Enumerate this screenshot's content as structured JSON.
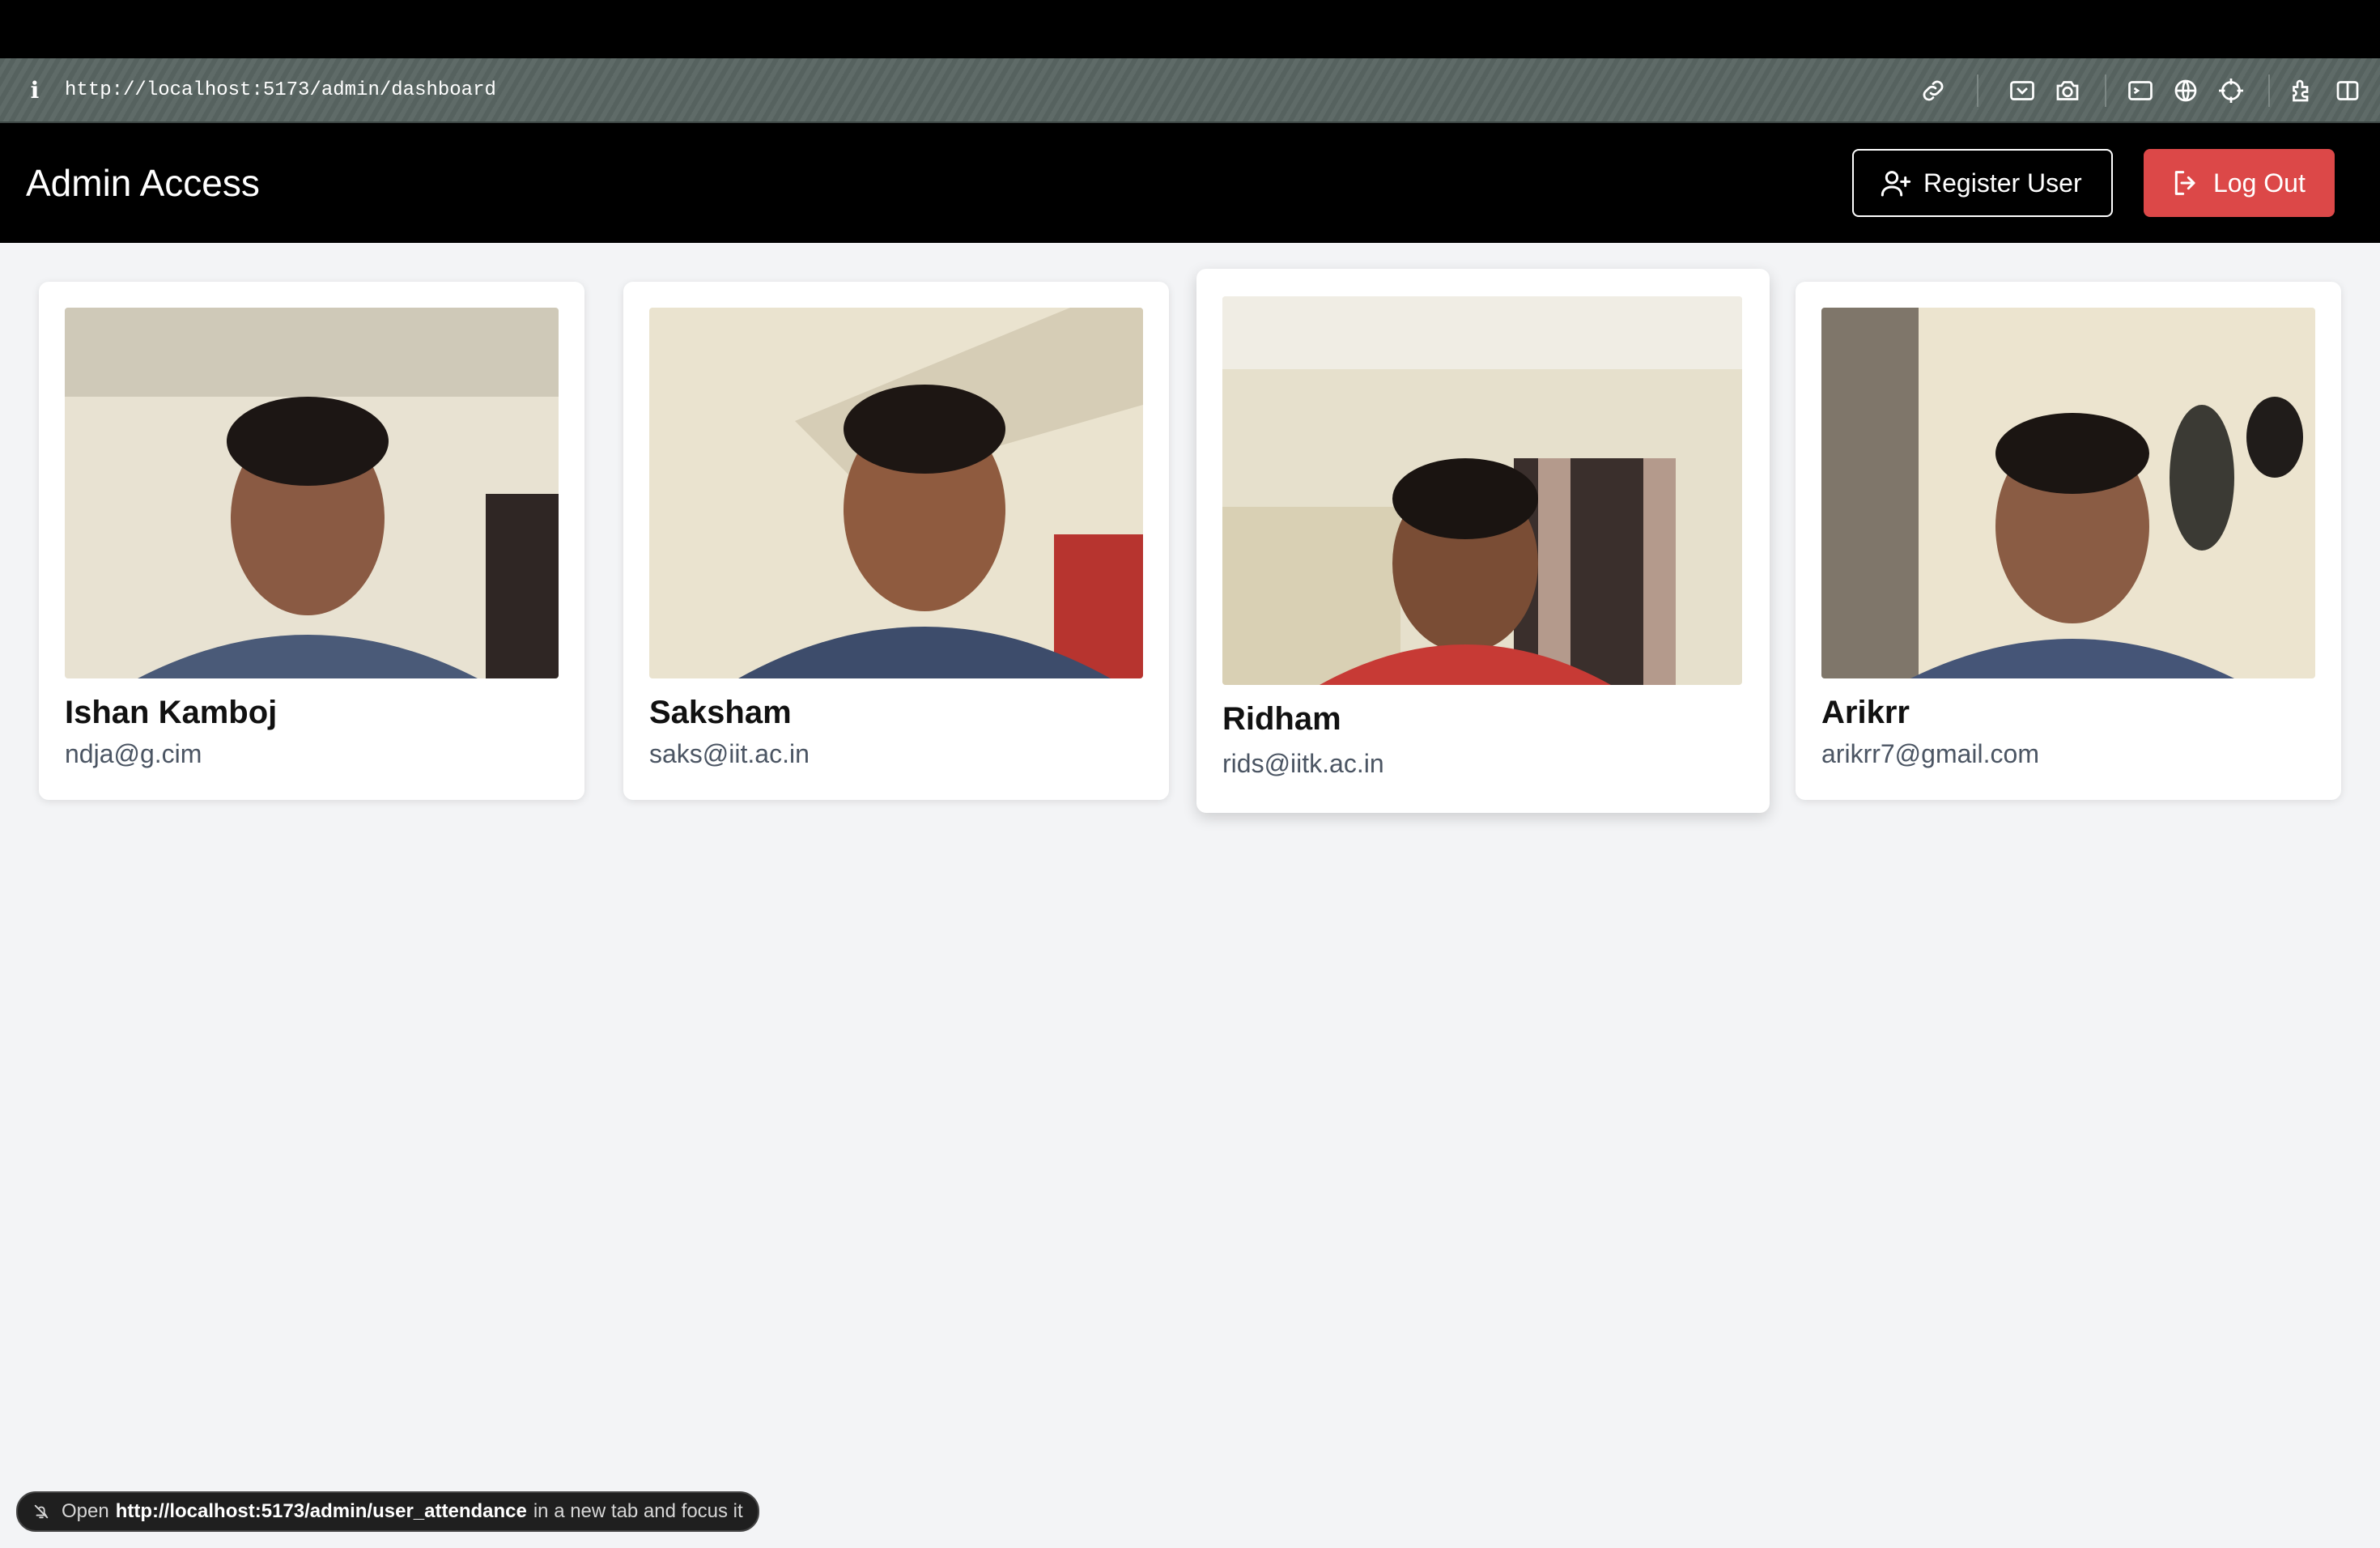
{
  "browser": {
    "url": "http://localhost:5173/admin/dashboard",
    "toolbar_icons": [
      "link-icon",
      "screenshot-area-icon",
      "camera-icon",
      "terminal-icon",
      "globe-icon",
      "crosshair-icon",
      "extensions-icon",
      "sidebar-icon"
    ]
  },
  "navbar": {
    "brand": "Admin Access",
    "register_label": "Register User",
    "logout_label": "Log Out",
    "logout_color": "#dc4848"
  },
  "users": [
    {
      "name": "Ishan Kamboj",
      "email": "ndja@g.cim"
    },
    {
      "name": "Saksham",
      "email": "saks@iit.ac.in"
    },
    {
      "name": "Ridham",
      "email": "rids@iitk.ac.in"
    },
    {
      "name": "Arikrr",
      "email": "arikrr7@gmail.com"
    }
  ],
  "status_bar": {
    "prefix": "Open",
    "link": "http://localhost:5173/admin/user_attendance",
    "suffix": "in a new tab and focus it"
  }
}
